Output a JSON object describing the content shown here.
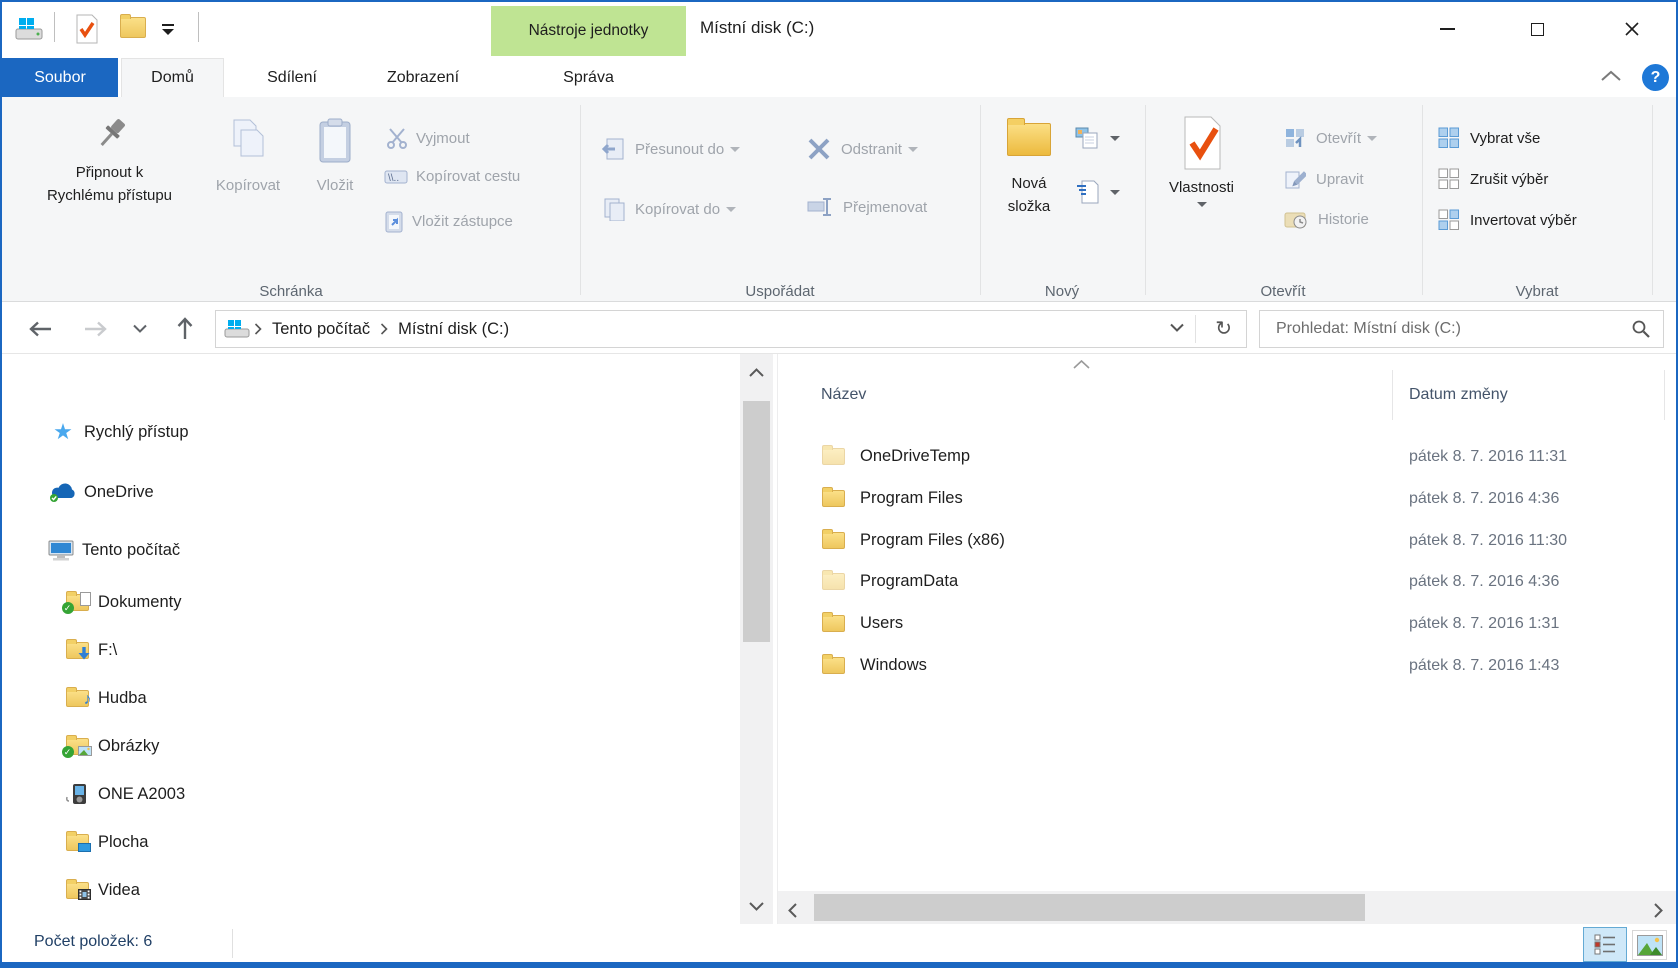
{
  "window": {
    "title": "Místní disk (C:)",
    "contextual_tab_header": "Nástroje jednotky"
  },
  "tabs": {
    "file": "Soubor",
    "home": "Domů",
    "share": "Sdílení",
    "view": "Zobrazení",
    "manage": "Správa"
  },
  "ribbon": {
    "groups": {
      "clipboard": {
        "label": "Schránka",
        "pin_line1": "Připnout k",
        "pin_line2": "Rychlému přístupu",
        "copy": "Kopírovat",
        "paste": "Vložit",
        "cut": "Vyjmout",
        "copy_path": "Kopírovat cestu",
        "paste_shortcut": "Vložit zástupce"
      },
      "organize": {
        "label": "Uspořádat",
        "move_to": "Přesunout do",
        "copy_to": "Kopírovat do",
        "delete": "Odstranit",
        "rename": "Přejmenovat"
      },
      "new": {
        "label": "Nový",
        "new_folder_line1": "Nová",
        "new_folder_line2": "složka"
      },
      "open": {
        "label": "Otevřít",
        "properties": "Vlastnosti",
        "open": "Otevřít",
        "edit": "Upravit",
        "history": "Historie"
      },
      "select": {
        "label": "Vybrat",
        "select_all": "Vybrat vše",
        "select_none": "Zrušit výběr",
        "invert": "Invertovat výběr"
      }
    }
  },
  "address": {
    "breadcrumb_root": "Tento počítač",
    "breadcrumb_current": "Místní disk (C:)"
  },
  "search": {
    "placeholder": "Prohledat: Místní disk (C:)"
  },
  "sidebar": {
    "items": [
      {
        "label": "Rychlý přístup",
        "icon": "quick-access-star"
      },
      {
        "label": "OneDrive",
        "icon": "onedrive-cloud"
      },
      {
        "label": "Tento počítač",
        "icon": "this-pc-monitor"
      },
      {
        "label": "Dokumenty",
        "icon": "documents-folder"
      },
      {
        "label": "F:\\",
        "icon": "folder-download"
      },
      {
        "label": "Hudba",
        "icon": "music-folder"
      },
      {
        "label": "Obrázky",
        "icon": "pictures-folder"
      },
      {
        "label": "ONE A2003",
        "icon": "portable-device"
      },
      {
        "label": "Plocha",
        "icon": "desktop-folder"
      },
      {
        "label": "Videa",
        "icon": "videos-folder"
      }
    ]
  },
  "files": {
    "columns": {
      "name": "Název",
      "date_modified": "Datum změny"
    },
    "rows": [
      {
        "name": "OneDriveTemp",
        "date": "pátek 8. 7. 2016 11:31",
        "hidden": true
      },
      {
        "name": "Program Files",
        "date": "pátek 8. 7. 2016 4:36",
        "hidden": false
      },
      {
        "name": "Program Files (x86)",
        "date": "pátek 8. 7. 2016 11:30",
        "hidden": false
      },
      {
        "name": "ProgramData",
        "date": "pátek 8. 7. 2016 4:36",
        "hidden": true
      },
      {
        "name": "Users",
        "date": "pátek 8. 7. 2016 1:31",
        "hidden": false
      },
      {
        "name": "Windows",
        "date": "pátek 8. 7. 2016 1:43",
        "hidden": false
      }
    ]
  },
  "statusbar": {
    "item_count": "Počet položek: 6"
  },
  "icons": {
    "help": "?"
  },
  "colors": {
    "accent_blue": "#1b67c1",
    "contextual_green": "#bfe493",
    "properties_check_orange": "#e8500f",
    "disabled_text": "#9fa4ab",
    "column_header": "#44546a"
  }
}
